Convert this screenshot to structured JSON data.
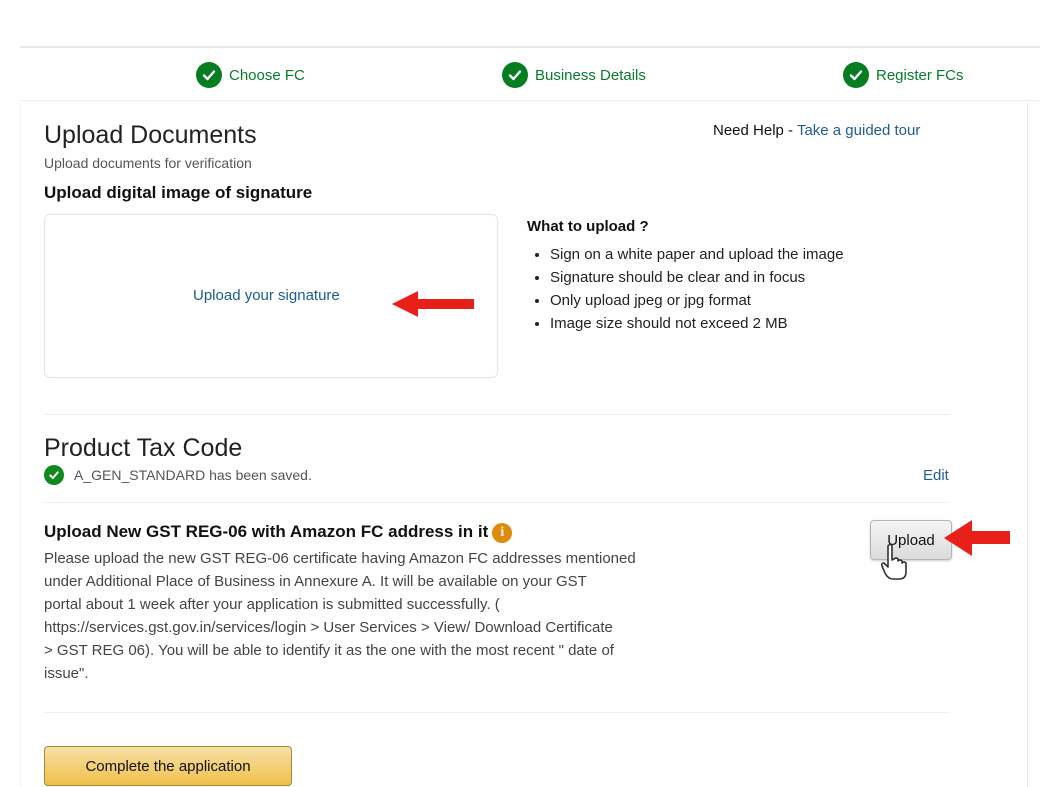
{
  "steps": [
    {
      "label": "Choose FC"
    },
    {
      "label": "Business Details"
    },
    {
      "label": "Register FCs"
    }
  ],
  "upload_documents": {
    "title": "Upload Documents",
    "subtitle": "Upload documents for verification",
    "help_prefix": "Need Help - ",
    "help_link": "Take a guided tour",
    "signature_heading": "Upload digital image of signature",
    "upload_signature_link": "Upload your signature",
    "what_to_upload_title": "What to upload ?",
    "bullets": [
      "Sign on a white paper and upload the image",
      "Signature should be clear and in focus",
      "Only upload jpeg or jpg format",
      "Image size should not exceed 2 MB"
    ]
  },
  "product_tax_code": {
    "title": "Product Tax Code",
    "saved_text": "A_GEN_STANDARD has been saved.",
    "edit_label": "Edit"
  },
  "gst": {
    "heading": "Upload New GST REG-06 with Amazon FC address in it",
    "info_icon": "info-icon",
    "description_lines": [
      "Please upload the new GST REG-06 certificate having Amazon FC addresses mentioned",
      "under Additional Place of Business in Annexure A. It will be available on your GST",
      "portal about 1 week after your application is submitted successfully. (",
      "https://services.gst.gov.in/services/login > User Services > View/ Download Certificate",
      "> GST REG 06). You will be able to identify it as the one with the most recent \" date of",
      "issue\"."
    ],
    "upload_label": "Upload"
  },
  "footer": {
    "complete_label": "Complete the application"
  },
  "colors": {
    "step_green": "#067d20",
    "link_blue": "#1f5c99",
    "annotation_red": "#e8201a",
    "primary_button": "#f0c14b",
    "info_orange": "#e08a0b"
  }
}
